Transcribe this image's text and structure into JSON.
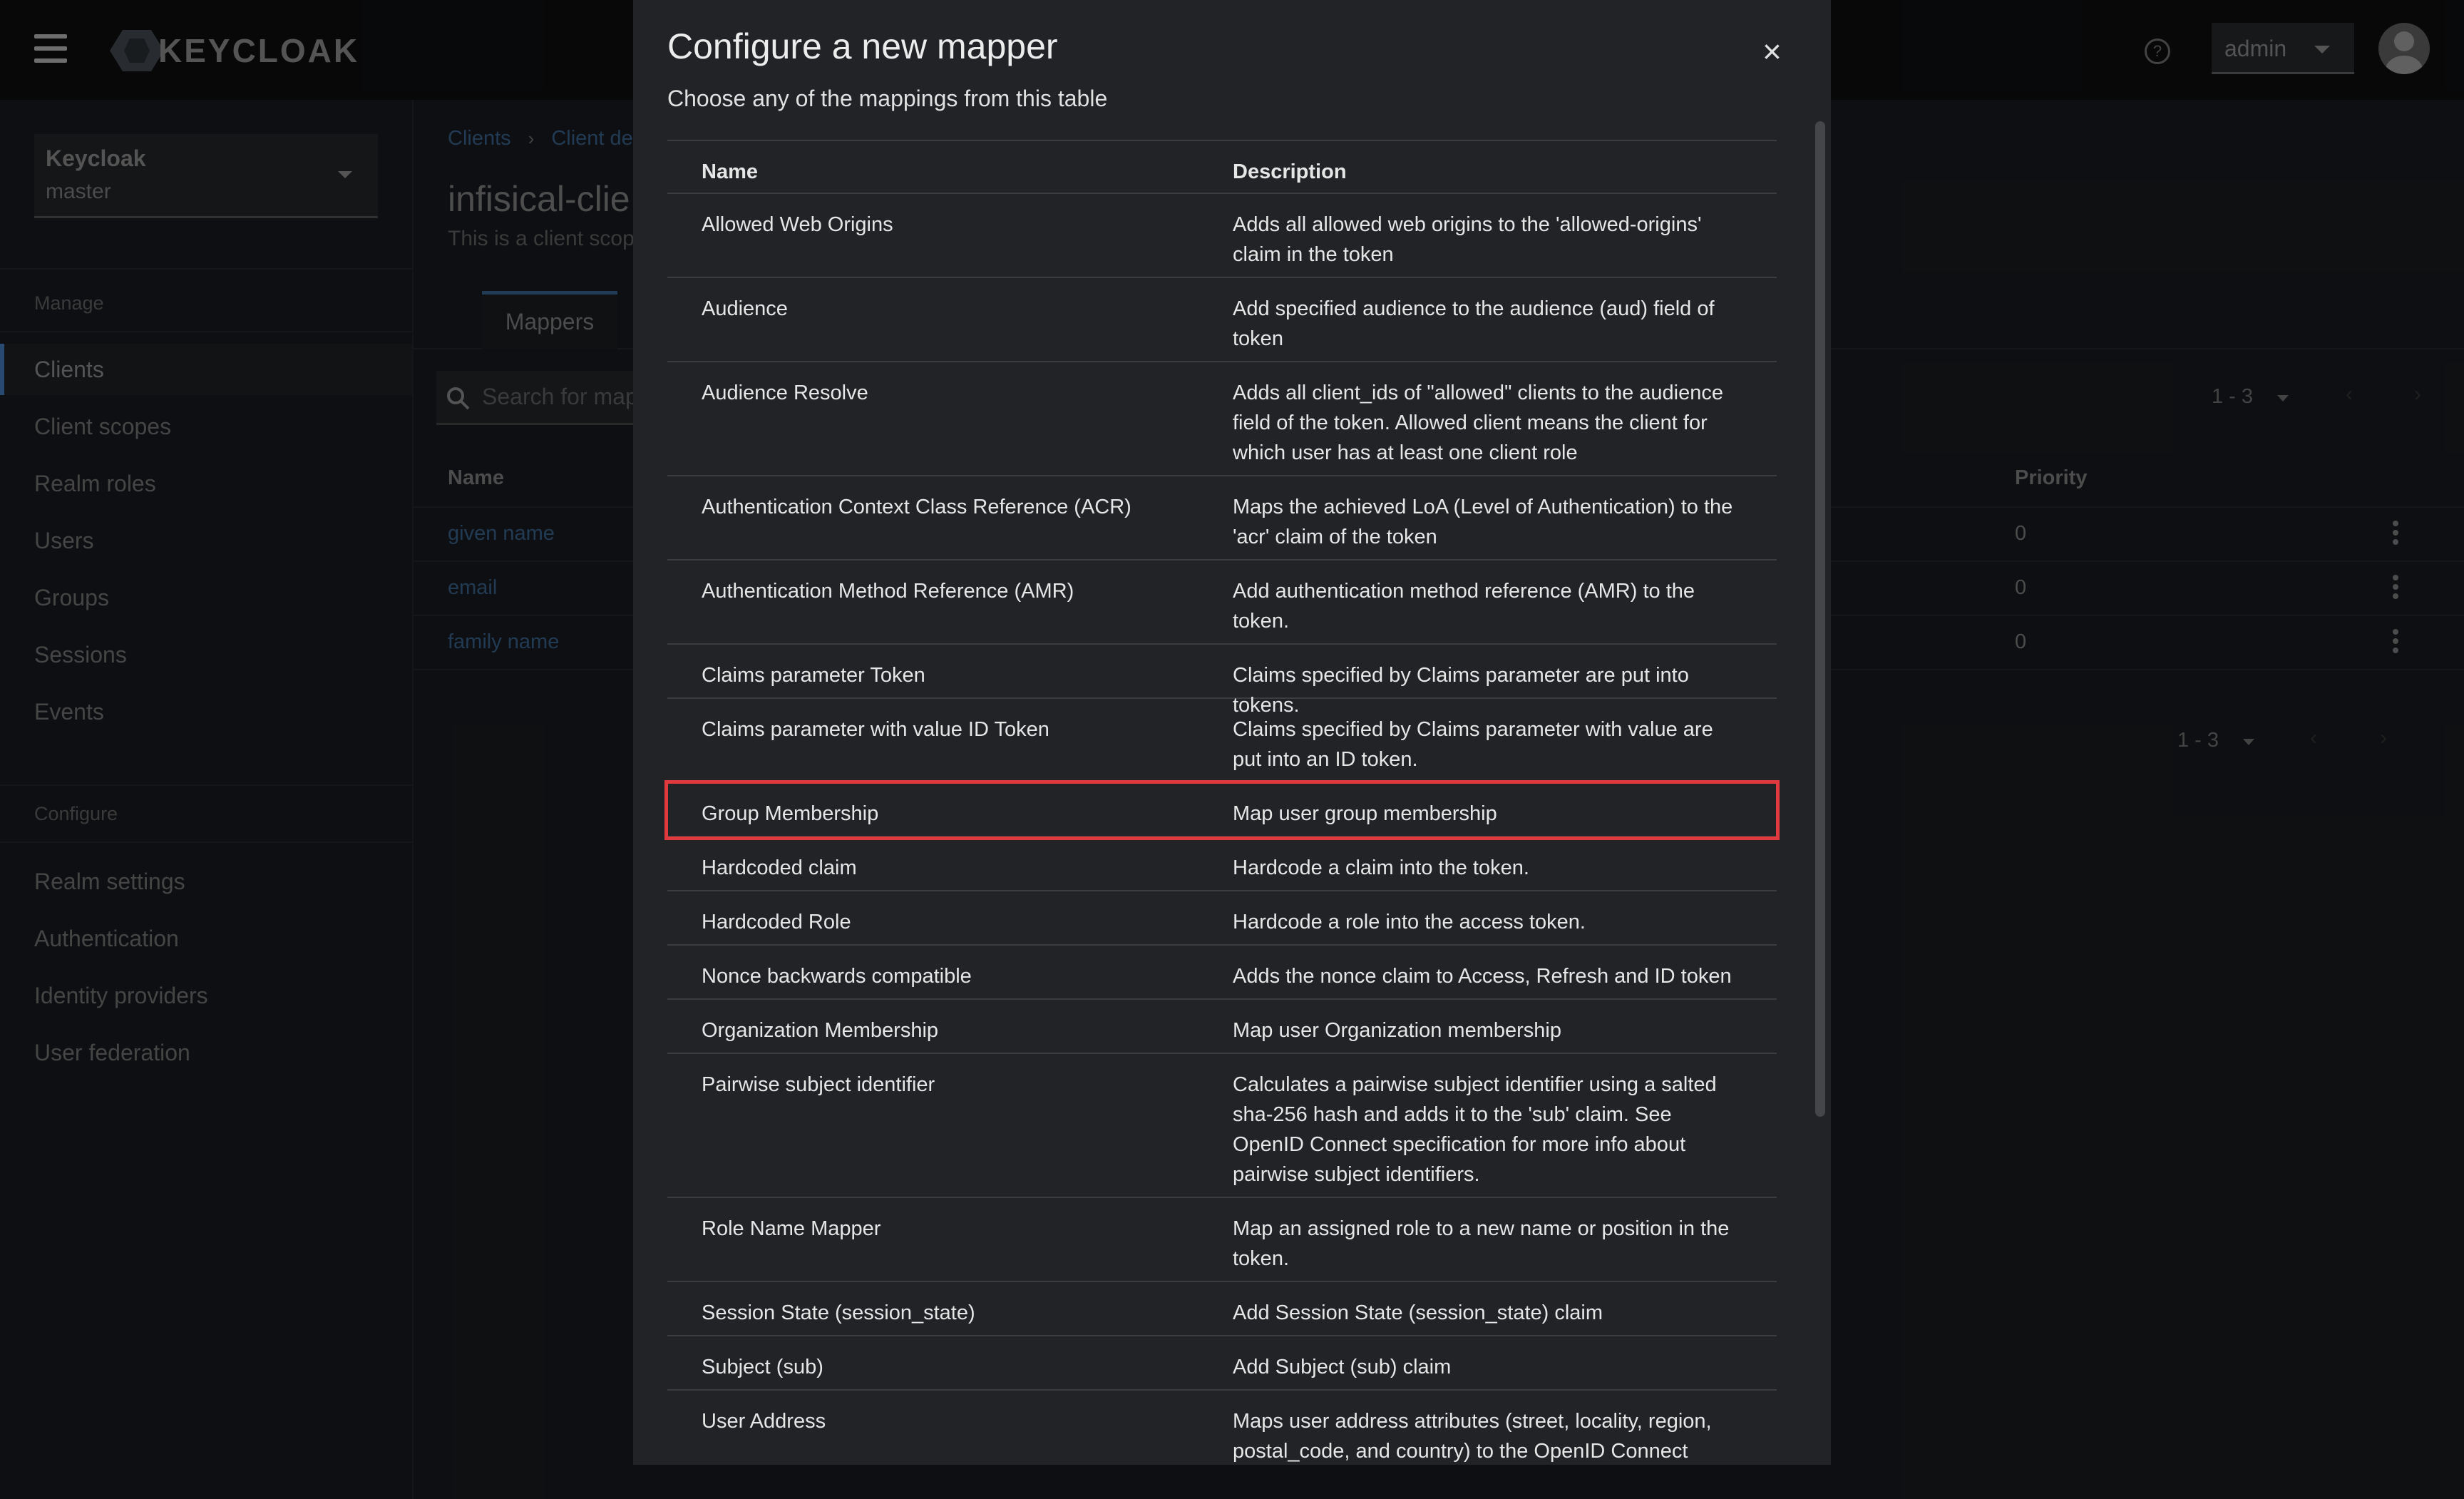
{
  "masthead": {
    "logo_text": "KEYCLOAK",
    "help_icon": "?",
    "user_label": "admin",
    "user_icon": "avatar-icon"
  },
  "sidebar": {
    "realm": {
      "name": "Keycloak",
      "value": "master"
    },
    "manage_label": "Manage",
    "manage_items": [
      {
        "label": "Clients",
        "active": true
      },
      {
        "label": "Client scopes"
      },
      {
        "label": "Realm roles"
      },
      {
        "label": "Users"
      },
      {
        "label": "Groups"
      },
      {
        "label": "Sessions"
      },
      {
        "label": "Events"
      }
    ],
    "configure_label": "Configure",
    "configure_items": [
      {
        "label": "Realm settings"
      },
      {
        "label": "Authentication"
      },
      {
        "label": "Identity providers"
      },
      {
        "label": "User federation"
      }
    ]
  },
  "page": {
    "breadcrumb": [
      "Clients",
      "Client de"
    ],
    "title": "infisical-clie",
    "subtitle": "This is a client scop",
    "tab": "Mappers",
    "search_placeholder": "Search for map",
    "pager_top": "1 - 3",
    "pager_bottom": "1 - 3",
    "col_name": "Name",
    "col_priority": "Priority",
    "rows": [
      {
        "name": "given name",
        "priority": "0"
      },
      {
        "name": "email",
        "priority": "0"
      },
      {
        "name": "family name",
        "priority": "0"
      }
    ]
  },
  "modal": {
    "title": "Configure a new mapper",
    "description": "Choose any of the mappings from this table",
    "close": "×",
    "col_name": "Name",
    "col_description": "Description",
    "highlight_color": "#e0393e",
    "rows": [
      {
        "name": "Allowed Web Origins",
        "description": "Adds all allowed web origins to the 'allowed-origins' claim in the token"
      },
      {
        "name": "Audience",
        "description": "Add specified audience to the audience (aud) field of token"
      },
      {
        "name": "Audience Resolve",
        "description": "Adds all client_ids of \"allowed\" clients to the audience field of the token. Allowed client means the client for which user has at least one client role"
      },
      {
        "name": "Authentication Context Class Reference (ACR)",
        "description": "Maps the achieved LoA (Level of Authentication) to the 'acr' claim of the token"
      },
      {
        "name": "Authentication Method Reference (AMR)",
        "description": "Add authentication method reference (AMR) to the token."
      },
      {
        "name": "Claims parameter Token",
        "description": "Claims specified by Claims parameter are put into tokens."
      },
      {
        "name": "Claims parameter with value ID Token",
        "description": "Claims specified by Claims parameter with value are put into an ID token."
      },
      {
        "name": "Group Membership",
        "description": "Map user group membership",
        "highlighted": true
      },
      {
        "name": "Hardcoded claim",
        "description": "Hardcode a claim into the token."
      },
      {
        "name": "Hardcoded Role",
        "description": "Hardcode a role into the access token."
      },
      {
        "name": "Nonce backwards compatible",
        "description": "Adds the nonce claim to Access, Refresh and ID token"
      },
      {
        "name": "Organization Membership",
        "description": "Map user Organization membership"
      },
      {
        "name": "Pairwise subject identifier",
        "description": "Calculates a pairwise subject identifier using a salted sha-256 hash and adds it to the 'sub' claim. See OpenID Connect specification for more info about pairwise subject identifiers."
      },
      {
        "name": "Role Name Mapper",
        "description": "Map an assigned role to a new name or position in the token."
      },
      {
        "name": "Session State (session_state)",
        "description": "Add Session State (session_state) claim"
      },
      {
        "name": "Subject (sub)",
        "description": "Add Subject (sub) claim"
      },
      {
        "name": "User Address",
        "description": "Maps user address attributes (street, locality, region, postal_code, and country) to the OpenID Connect"
      }
    ]
  }
}
